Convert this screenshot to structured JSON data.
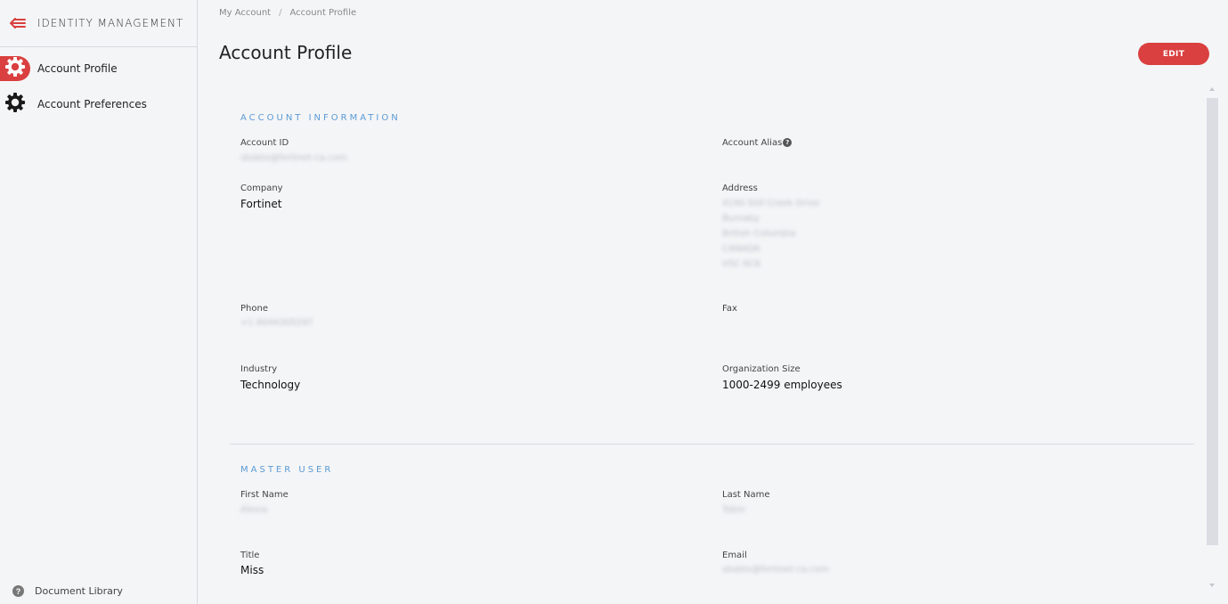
{
  "sidebar": {
    "title": "IDENTITY MANAGEMENT",
    "items": [
      {
        "label": "Account Profile",
        "active": true
      },
      {
        "label": "Account Preferences",
        "active": false
      }
    ],
    "footer_label": "Document Library"
  },
  "breadcrumb": [
    "My Account",
    "Account Profile"
  ],
  "page_title": "Account Profile",
  "edit_label": "EDIT",
  "account_info": {
    "section_title": "ACCOUNT INFORMATION",
    "account_id": {
      "label": "Account ID",
      "value": "sbsbtx@fortinet-ca.com"
    },
    "account_alias": {
      "label": "Account Alias",
      "value": ""
    },
    "company": {
      "label": "Company",
      "value": "Fortinet"
    },
    "address": {
      "label": "Address",
      "lines": [
        "4190 Still Creek Drive",
        "Burnaby",
        "British Columbia",
        "CANADA",
        "V5C 6C6"
      ]
    },
    "phone": {
      "label": "Phone",
      "value": "+1 6044305297"
    },
    "fax": {
      "label": "Fax",
      "value": ""
    },
    "industry": {
      "label": "Industry",
      "value": "Technology"
    },
    "org_size": {
      "label": "Organization Size",
      "value": "1000-2499 employees"
    }
  },
  "master_user": {
    "section_title": "MASTER USER",
    "first_name": {
      "label": "First Name",
      "value": "Alexia"
    },
    "last_name": {
      "label": "Last Name",
      "value": "Tobin"
    },
    "title": {
      "label": "Title",
      "value": "Miss"
    },
    "email": {
      "label": "Email",
      "value": "sbsbtx@fortinet-ca.com"
    }
  },
  "colors": {
    "accent": "#d9403f",
    "section_title": "#5b9bd5",
    "background": "#f4f5f7"
  },
  "icons": [
    "collapse-menu-icon",
    "gear-icon",
    "help-icon"
  ]
}
